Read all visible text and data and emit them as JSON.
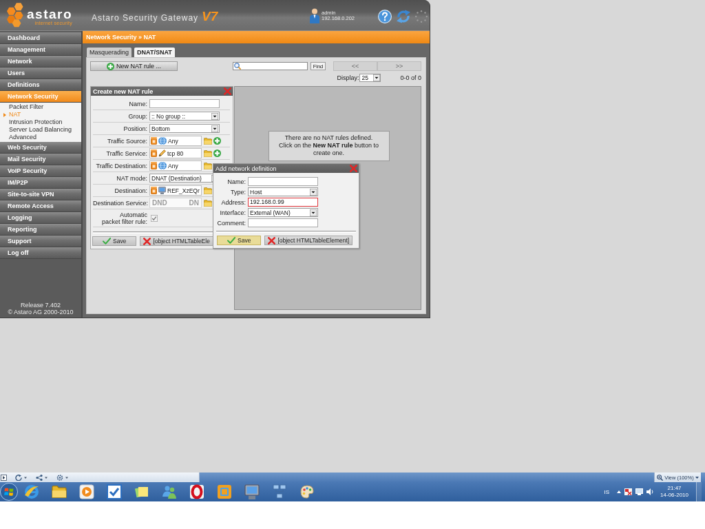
{
  "header": {
    "brand": "astaro",
    "tagline": "internet security",
    "product": "Astaro Security Gateway",
    "version": "V7",
    "user": {
      "name": "admin",
      "address": "192.168.0.202"
    }
  },
  "sidebar": {
    "items": [
      {
        "label": "Dashboard",
        "selected": false
      },
      {
        "label": "Management",
        "selected": false
      },
      {
        "label": "Network",
        "selected": false
      },
      {
        "label": "Users",
        "selected": false
      },
      {
        "label": "Definitions",
        "selected": false
      },
      {
        "label": "Network Security",
        "selected": true,
        "children": [
          {
            "label": "Packet Filter",
            "selected": false
          },
          {
            "label": "NAT",
            "selected": true
          },
          {
            "label": "Intrusion Protection",
            "selected": false
          },
          {
            "label": "Server Load Balancing",
            "selected": false
          },
          {
            "label": "Advanced",
            "selected": false
          }
        ]
      },
      {
        "label": "Web Security",
        "selected": false
      },
      {
        "label": "Mail Security",
        "selected": false
      },
      {
        "label": "VoIP Security",
        "selected": false
      },
      {
        "label": "IM/P2P",
        "selected": false
      },
      {
        "label": "Site-to-site VPN",
        "selected": false
      },
      {
        "label": "Remote Access",
        "selected": false
      },
      {
        "label": "Logging",
        "selected": false
      },
      {
        "label": "Reporting",
        "selected": false
      },
      {
        "label": "Support",
        "selected": false
      },
      {
        "label": "Log off",
        "selected": false
      }
    ],
    "release": "Release 7.402",
    "copyright": "© Astaro AG 2000-2010"
  },
  "breadcrumb": "Network Security » NAT",
  "tabs": [
    {
      "label": "Masquerading",
      "selected": false
    },
    {
      "label": "DNAT/SNAT",
      "selected": true
    }
  ],
  "toolbar": {
    "new_button": "New NAT rule ...",
    "find_button": "Find",
    "pager": [
      {
        "label": "<<",
        "disabled": true
      },
      {
        "label": ">>",
        "disabled": true
      }
    ],
    "display_label": "Display:",
    "page_size": "25",
    "count": "0-0 of 0"
  },
  "rule_form": {
    "title": "Create new NAT rule",
    "fields": [
      {
        "kind": "text",
        "label": "Name:"
      },
      {
        "kind": "select",
        "label": "Group:",
        "value": ":: No group ::"
      },
      {
        "kind": "select",
        "label": "Position:",
        "value": "Bottom"
      },
      {
        "kind": "object",
        "label": "Traffic Source:",
        "object": {
          "kind": "network",
          "name": "Any"
        },
        "add": true
      },
      {
        "kind": "object",
        "label": "Traffic Service:",
        "object": {
          "kind": "service",
          "name": "tcp 80"
        },
        "add": true
      },
      {
        "kind": "object",
        "label": "Traffic Destination:",
        "object": {
          "kind": "network",
          "name": "Any"
        },
        "add": false
      },
      {
        "kind": "select",
        "label": "NAT mode:",
        "value": "DNAT (Destination)"
      },
      {
        "kind": "object",
        "label": "Destination:",
        "object": {
          "kind": "host",
          "name": "REF_XzEQr"
        },
        "add": false
      },
      {
        "kind": "dropzone",
        "label": "Destination Service:",
        "ghost": [
          "DND",
          "DN"
        ]
      },
      {
        "kind": "checkbox",
        "label": [
          "Automatic",
          "packet filter rule:"
        ],
        "checked": true
      }
    ],
    "buttons": [
      {
        "kind": "save",
        "label": "Save",
        "highlighted": false
      },
      {
        "kind": "cancel",
        "label": "[object HTMLTableEle",
        "highlighted": false
      }
    ]
  },
  "rule_list": {
    "message": "There are no NAT rules defined. Click on the **New NAT rule** button to create one."
  },
  "dialog": {
    "title": "Add network definition",
    "fields": [
      {
        "kind": "text",
        "label": "Name:",
        "highlighted": false
      },
      {
        "kind": "select",
        "label": "Type:",
        "value": "Host",
        "highlighted": false
      },
      {
        "kind": "text",
        "label": "Address:",
        "value": "192.168.0.99",
        "highlighted": true
      },
      {
        "kind": "select",
        "label": "Interface:",
        "value": "External (WAN)",
        "highlighted": false
      },
      {
        "kind": "text",
        "label": "Comment:",
        "highlighted": false
      }
    ],
    "buttons": [
      {
        "kind": "save",
        "label": "Save",
        "highlighted": true
      },
      {
        "kind": "cancel",
        "label": "[object HTMLTableElement]",
        "highlighted": false
      }
    ]
  },
  "status_bar": {
    "zoom": "View (100%)"
  },
  "taskbar": {
    "language": "IS",
    "time": "21:47",
    "date": "14-06-2010"
  }
}
